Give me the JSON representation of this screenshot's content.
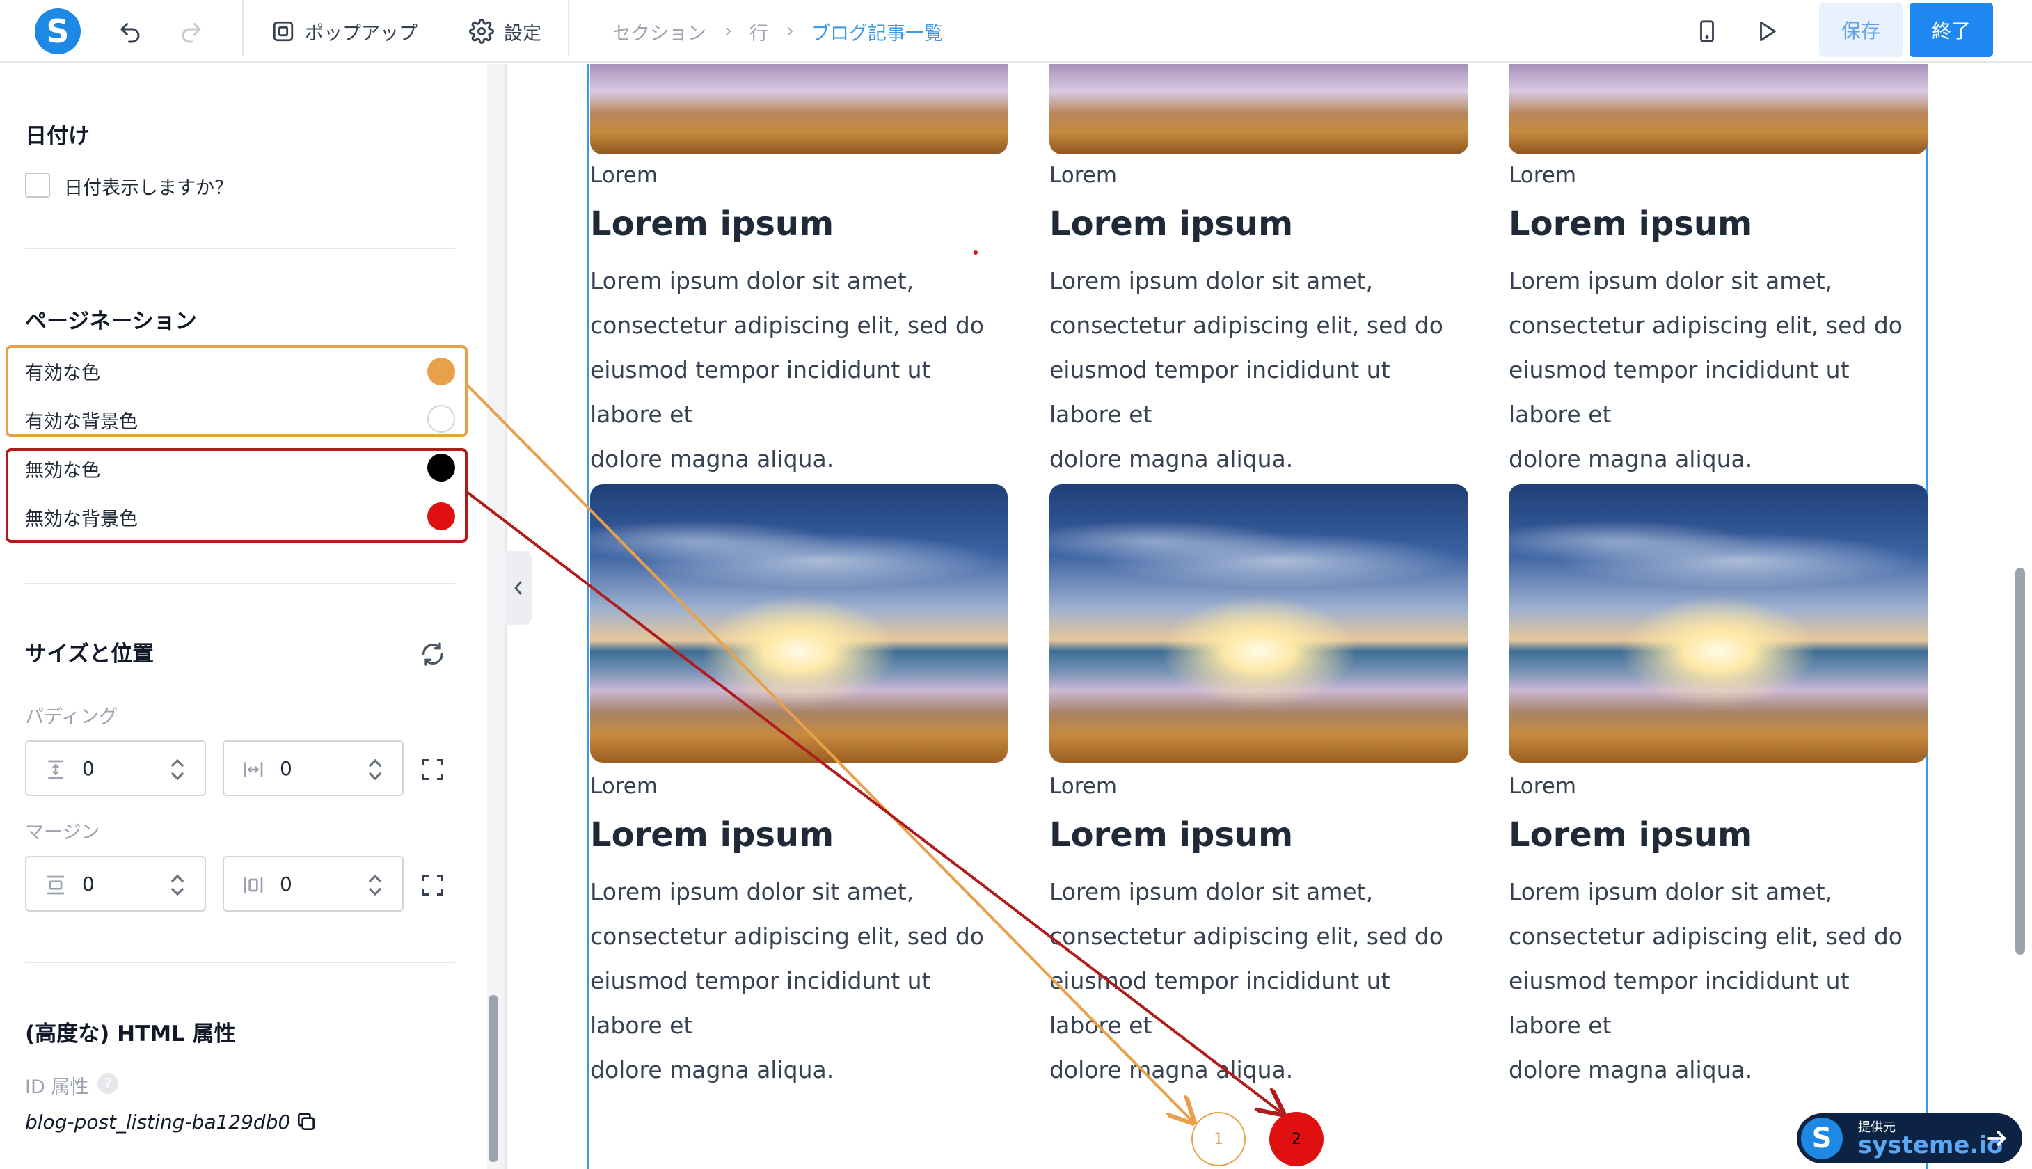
{
  "app": {
    "logo_letter": "S",
    "brand_color": "#1e88e5"
  },
  "toolbar": {
    "undo_icon": "undo-icon",
    "redo_icon": "redo-icon",
    "popup_label": "ポップアップ",
    "settings_label": "設定",
    "breadcrumbs": [
      "セクション",
      "行",
      "ブログ記事一覧"
    ],
    "save_label": "保存",
    "done_label": "終了"
  },
  "panel": {
    "date": {
      "title": "日付け",
      "checkbox_label": "日付表示しますか？",
      "checked": false
    },
    "pagination": {
      "title": "ページネーション",
      "active_color_label": "有効な色",
      "active_color": "#e8a04a",
      "active_bg_label": "有効な背景色",
      "active_bg": "#ffffff",
      "inactive_color_label": "無効な色",
      "inactive_color": "#000000",
      "inactive_bg_label": "無効な背景色",
      "inactive_bg": "#e01010"
    },
    "size_position": {
      "title": "サイズと位置",
      "padding_label": "パディング",
      "padding_vertical": "0",
      "padding_horizontal": "0",
      "margin_label": "マージン",
      "margin_vertical": "0",
      "margin_horizontal": "0"
    },
    "advanced": {
      "title": "(高度な) HTML 属性",
      "id_label": "ID 属性",
      "id_value": "blog-post_listing-ba129db0"
    }
  },
  "blog": {
    "posts": [
      {
        "category": "Lorem",
        "title": "Lorem ipsum",
        "lines": [
          "Lorem ipsum dolor sit amet,",
          "consectetur adipiscing elit, sed do",
          "eiusmod tempor incididunt ut labore et",
          "dolore magna aliqua."
        ]
      },
      {
        "category": "Lorem",
        "title": "Lorem ipsum",
        "lines": [
          "Lorem ipsum dolor sit amet,",
          "consectetur adipiscing elit, sed do",
          "eiusmod tempor incididunt ut labore et",
          "dolore magna aliqua."
        ]
      },
      {
        "category": "Lorem",
        "title": "Lorem ipsum",
        "lines": [
          "Lorem ipsum dolor sit amet,",
          "consectetur adipiscing elit, sed do",
          "eiusmod tempor incididunt ut labore et",
          "dolore magna aliqua."
        ]
      },
      {
        "category": "Lorem",
        "title": "Lorem ipsum",
        "lines": [
          "Lorem ipsum dolor sit amet,",
          "consectetur adipiscing elit, sed do",
          "eiusmod tempor incididunt ut labore et",
          "dolore magna aliqua."
        ]
      },
      {
        "category": "Lorem",
        "title": "Lorem ipsum",
        "lines": [
          "Lorem ipsum dolor sit amet,",
          "consectetur adipiscing elit, sed do",
          "eiusmod tempor incididunt ut labore et",
          "dolore magna aliqua."
        ]
      },
      {
        "category": "Lorem",
        "title": "Lorem ipsum",
        "lines": [
          "Lorem ipsum dolor sit amet,",
          "consectetur adipiscing elit, sed do",
          "eiusmod tempor incididunt ut labore et",
          "dolore magna aliqua."
        ]
      }
    ],
    "pagination": {
      "page1": "1",
      "page2": "2"
    }
  },
  "annotations": {
    "active_color": "#e8a04a",
    "inactive_color": "#b01c1c"
  },
  "badge": {
    "small_label": "提供元",
    "brand": "systeme.io"
  }
}
